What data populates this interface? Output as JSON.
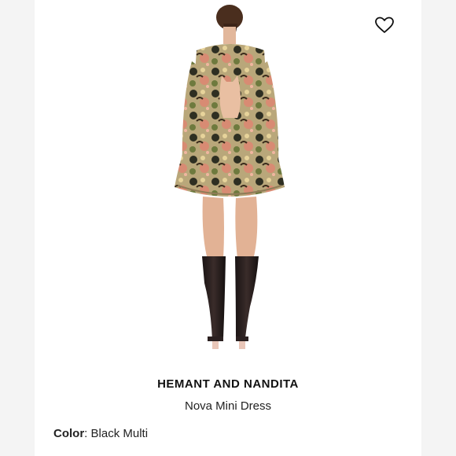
{
  "product": {
    "brand": "HEMANT AND NANDITA",
    "name": "Nova Mini Dress",
    "color_label": "Color",
    "color_value": "Black Multi"
  },
  "icons": {
    "favorite": "heart-icon"
  },
  "colors": {
    "background": "#ffffff",
    "text": "#111111"
  }
}
